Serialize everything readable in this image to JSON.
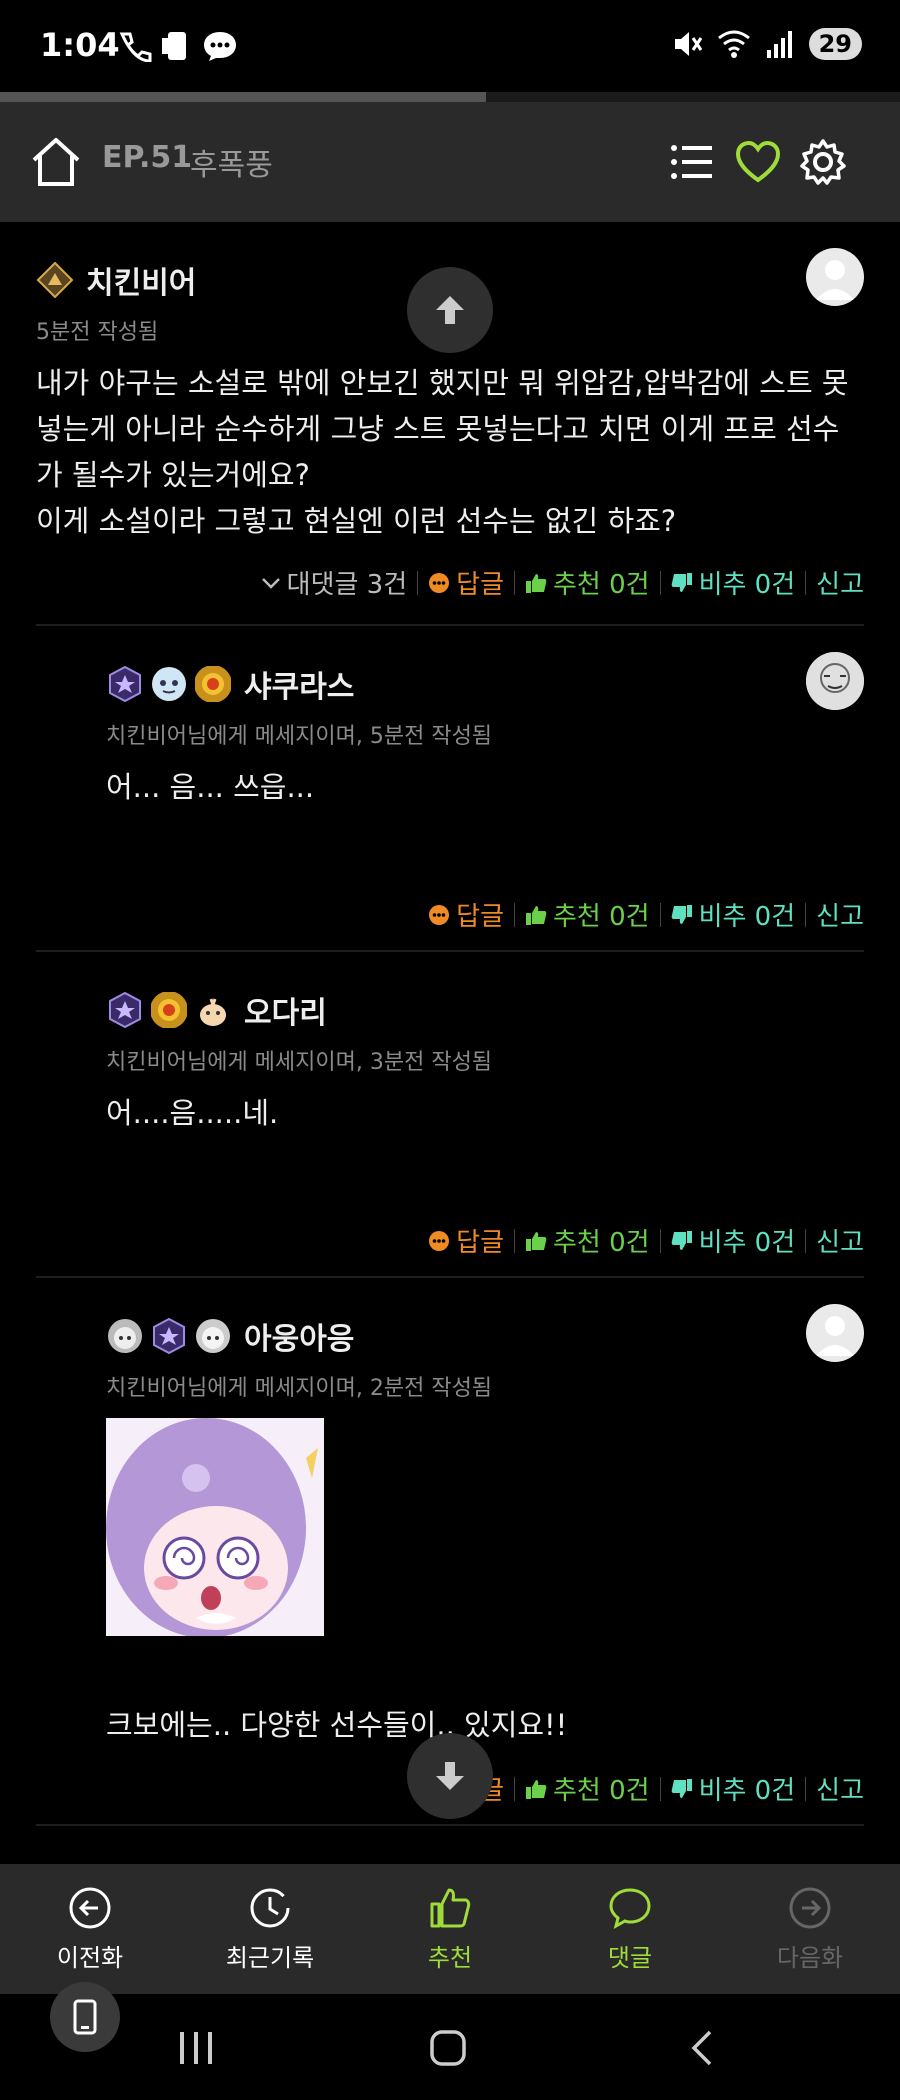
{
  "status_bar": {
    "time": "1:04",
    "battery": "29"
  },
  "progress": {
    "fraction": 0.54
  },
  "header": {
    "episode": "EP.51",
    "subtitle": "후폭풍"
  },
  "comments": [
    {
      "author": "치킨비어",
      "meta": "5분전 작성됨",
      "body": "내가 야구는 소설로 밖에 안보긴 했지만 뭐 위압감,압박감에 스트 못넣는게 아니라 순수하게 그냥 스트 못넣는다고 치면 이게 프로 선수가 될수가 있는거에요?\n이게 소설이라 그렇고 현실엔 이런 선수는 없긴 하죠?",
      "replies_label": "대댓글 3건",
      "reply_label": "답글",
      "up_label": "추천 0건",
      "down_label": "비추 0건",
      "report_label": "신고"
    },
    {
      "author": "샤쿠라스",
      "meta": "치킨비어님에게 메세지이며, 5분전 작성됨",
      "body": "어... 음... 쓰읍...",
      "reply_label": "답글",
      "up_label": "추천 0건",
      "down_label": "비추 0건",
      "report_label": "신고"
    },
    {
      "author": "오다리",
      "meta": "치킨비어님에게 메세지이며, 3분전 작성됨",
      "body": "어....음.....네.",
      "reply_label": "답글",
      "up_label": "추천 0건",
      "down_label": "비추 0건",
      "report_label": "신고"
    },
    {
      "author": "아웅아응",
      "meta": "치킨비어님에게 메세지이며, 2분전 작성됨",
      "body": "크보에는.. 다양한 선수들이.. 있지요!!",
      "reply_label": "답글",
      "up_label": "추천 0건",
      "down_label": "비추 0건",
      "report_label": "신고"
    }
  ],
  "bottom_nav": [
    {
      "label": "이전화",
      "icon": "arrow-left-circle-icon",
      "color": "#ffffff"
    },
    {
      "label": "최근기록",
      "icon": "history-icon",
      "color": "#ffffff"
    },
    {
      "label": "추천",
      "icon": "thumbs-up-icon",
      "color": "#9fdc3a"
    },
    {
      "label": "댓글",
      "icon": "chat-bubble-icon",
      "color": "#9fdc3a"
    },
    {
      "label": "다음화",
      "icon": "arrow-right-circle-icon",
      "color": "#666666"
    }
  ],
  "colors": {
    "accent": "#9fdc3a",
    "reply": "#f08a24",
    "up": "#6cd14a",
    "down": "#5fe0c0"
  }
}
